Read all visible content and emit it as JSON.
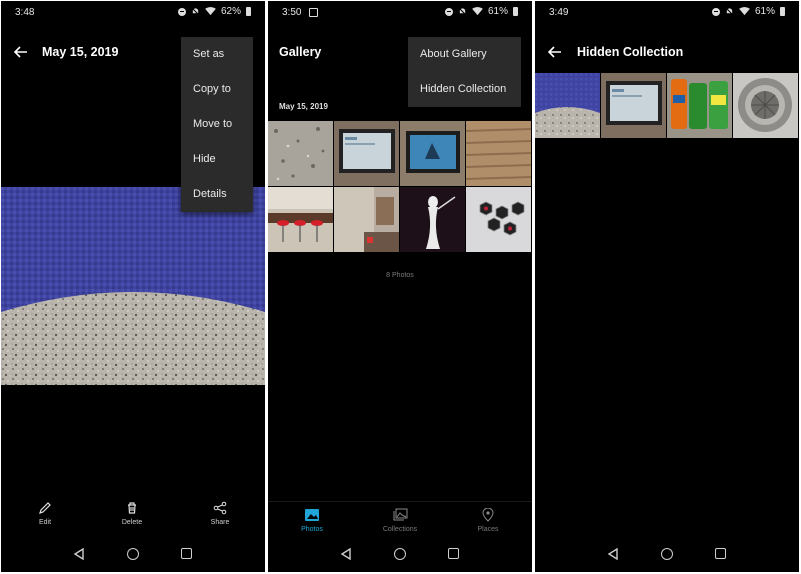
{
  "panels": [
    {
      "status": {
        "time": "3:48",
        "battery": "62%"
      },
      "title": "May 15, 2019",
      "menu": [
        "Set as",
        "Copy to",
        "Move to",
        "Hide",
        "Details"
      ],
      "actions": [
        "Edit",
        "Delete",
        "Share"
      ]
    },
    {
      "status": {
        "time": "3:50",
        "battery": "61%"
      },
      "title": "Gallery",
      "menu": [
        "About Gallery",
        "Hidden Collection"
      ],
      "date_header": "May 15, 2019",
      "photo_count": "8 Photos",
      "tabs": [
        {
          "label": "Photos",
          "active": true
        },
        {
          "label": "Collections",
          "active": false
        },
        {
          "label": "Places",
          "active": false
        }
      ],
      "accent_color": "#1fa5d6"
    },
    {
      "status": {
        "time": "3:49",
        "battery": "61%"
      },
      "title": "Hidden Collection"
    }
  ]
}
